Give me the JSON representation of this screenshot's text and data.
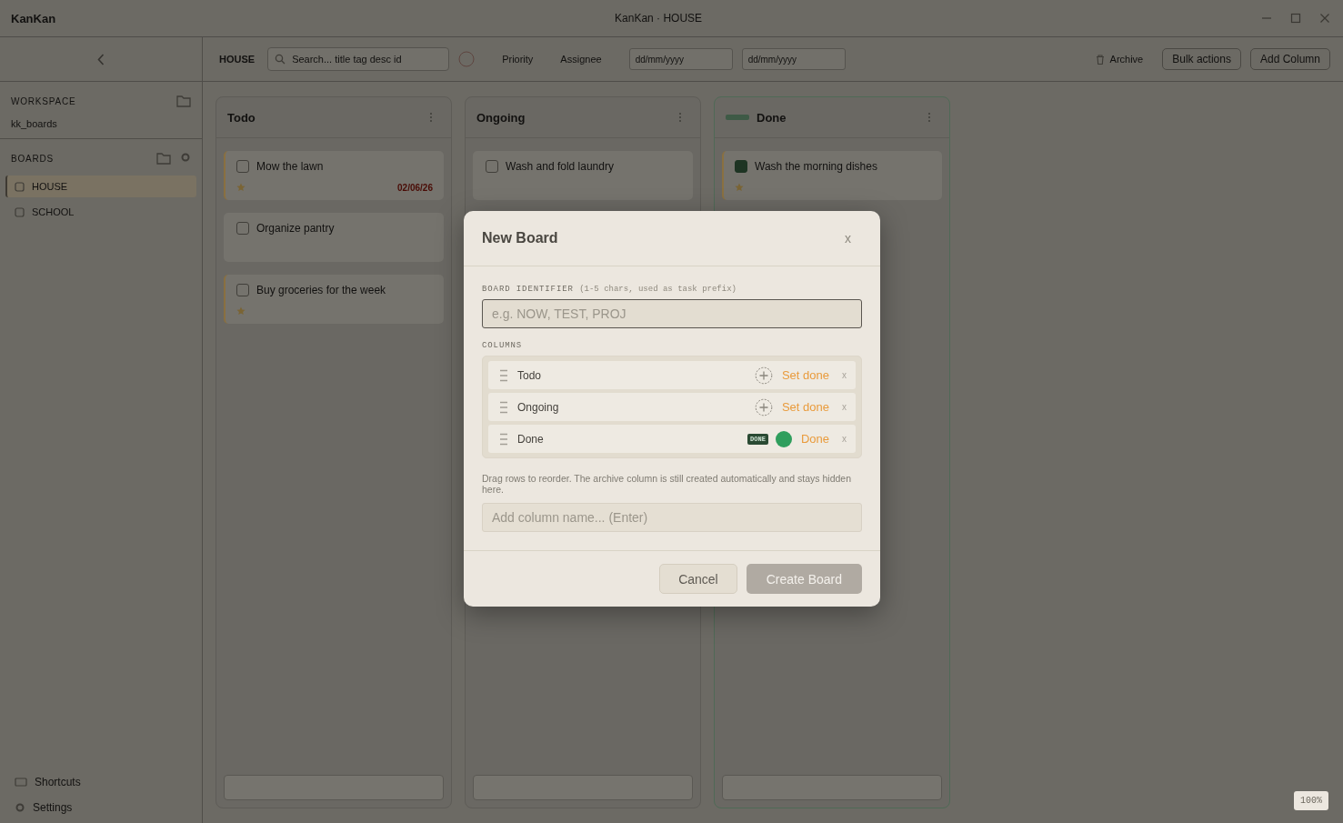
{
  "window": {
    "title": "KanKan",
    "subtitle": "KanKan · HOUSE"
  },
  "sidebar": {
    "workspace_label": "WORKSPACE",
    "workspace_path": "kk_boards",
    "boards_label": "BOARDS",
    "boards": [
      {
        "label": "HOUSE",
        "selected": true
      },
      {
        "label": "SCHOOL",
        "selected": false
      }
    ],
    "footer": [
      "Shortcuts",
      "Settings"
    ]
  },
  "toolbar": {
    "board": "HOUSE",
    "search_placeholder": "Search... title tag desc id",
    "filters": [
      "Priority",
      "Assignee"
    ],
    "date_from": "dd/mm/yyyy",
    "date_to": "dd/mm/yyyy",
    "buttons": [
      "Archive",
      "Bulk actions",
      "Add Column"
    ]
  },
  "columns": [
    {
      "title": "Todo",
      "done": false,
      "tasks": [
        {
          "title": "Mow the lawn",
          "checked": false,
          "flag": true,
          "due": "02/06/26"
        },
        {
          "title": "Organize pantry",
          "checked": false,
          "flag": false
        },
        {
          "title": "Buy groceries for the week",
          "checked": false,
          "flag": true
        }
      ]
    },
    {
      "title": "Ongoing",
      "done": false,
      "tasks": [
        {
          "title": "Wash and fold laundry",
          "checked": false,
          "flag": false
        }
      ]
    },
    {
      "title": "Done",
      "done": true,
      "tasks": [
        {
          "title": "Wash the morning dishes",
          "checked": true,
          "flag": true
        }
      ]
    }
  ],
  "dialog": {
    "title": "New Board",
    "close": "x",
    "identifier_label": "BOARD IDENTIFIER",
    "identifier_hint": "(1-5 chars, used as task prefix)",
    "identifier_placeholder": "e.g. NOW, TEST, PROJ",
    "columns_label": "COLUMNS",
    "columns": [
      {
        "name": "Todo",
        "done": false,
        "action": "Set done",
        "remove": "x"
      },
      {
        "name": "Ongoing",
        "done": false,
        "action": "Set done",
        "remove": "x"
      },
      {
        "name": "Done",
        "done": true,
        "badge": "DONE",
        "action": "Done",
        "remove": "x"
      }
    ],
    "help": "Drag rows to reorder. The archive column is still created automatically and stays hidden here.",
    "add_placeholder": "Add column name... (Enter)",
    "buttons": [
      {
        "label": "Cancel",
        "kind": "secondary",
        "disabled": false
      },
      {
        "label": "Create Board",
        "kind": "primary",
        "disabled": true
      }
    ]
  },
  "zoom": "100%"
}
